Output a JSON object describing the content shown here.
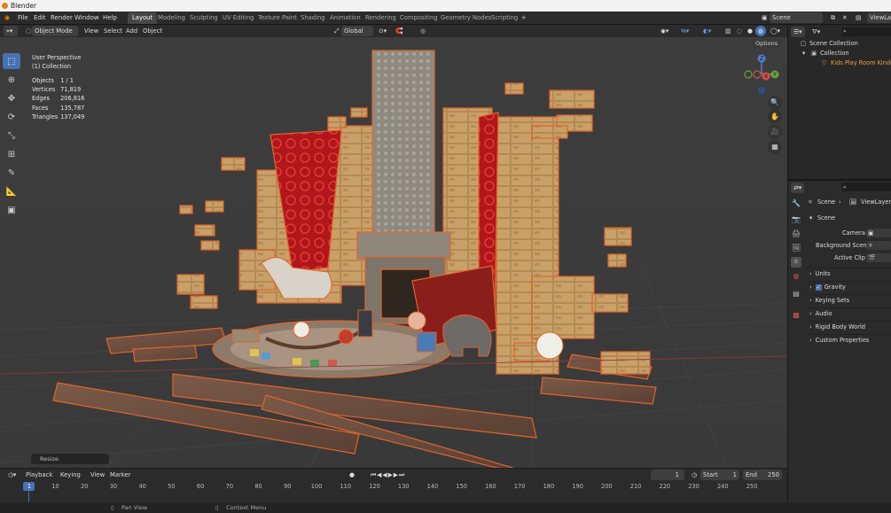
{
  "window": {
    "title": "Blender"
  },
  "menu": [
    "File",
    "Edit",
    "Render",
    "Window",
    "Help"
  ],
  "workspaces": [
    "Layout",
    "Modeling",
    "Sculpting",
    "UV Editing",
    "Texture Paint",
    "Shading",
    "Animation",
    "Rendering",
    "Compositing",
    "Geometry Nodes",
    "Scripting"
  ],
  "active_workspace": "Layout",
  "add_workspace": "+",
  "scene_name": "Scene",
  "viewlayer_name": "ViewLayer",
  "header": {
    "mode": "Object Mode",
    "view": "View",
    "select": "Select",
    "add": "Add",
    "object": "Object",
    "orientation": "Global",
    "options": "Options"
  },
  "viewport": {
    "perspective": "User Perspective",
    "collection": "(1) Collection",
    "stats": [
      {
        "label": "Objects",
        "value": "1 / 1"
      },
      {
        "label": "Vertices",
        "value": "71,819"
      },
      {
        "label": "Edges",
        "value": "206,816"
      },
      {
        "label": "Faces",
        "value": "135,787"
      },
      {
        "label": "Triangles",
        "value": "137,049"
      }
    ],
    "gizmo": {
      "x": "X",
      "y": "Y",
      "z": "Z"
    },
    "last_op": "Resize"
  },
  "timeline": {
    "playback": "Playback",
    "keying": "Keying",
    "view": "View",
    "marker": "Marker",
    "current_frame": "1",
    "start_label": "Start",
    "start": "1",
    "end_label": "End",
    "end": "250",
    "ticks": [
      "1",
      "10",
      "20",
      "30",
      "40",
      "50",
      "60",
      "70",
      "80",
      "90",
      "100",
      "110",
      "120",
      "130",
      "140",
      "150",
      "160",
      "170",
      "180",
      "190",
      "200",
      "210",
      "220",
      "230",
      "240",
      "250"
    ]
  },
  "status": {
    "pan": "Pan View",
    "context": "Context Menu"
  },
  "outliner": {
    "scene_collection": "Scene Collection",
    "collection": "Collection",
    "object": "Kids Play Room Kindergarten"
  },
  "properties": {
    "breadcrumb_scene": "Scene",
    "breadcrumb_layer": "ViewLayer",
    "panel_title": "Scene",
    "camera_label": "Camera",
    "bg_scene_label": "Background Scene",
    "active_clip_label": "Active Clip",
    "sections": [
      "Units",
      "Gravity",
      "Keying Sets",
      "Audio",
      "Rigid Body World",
      "Custom Properties"
    ],
    "gravity_checked": true
  }
}
